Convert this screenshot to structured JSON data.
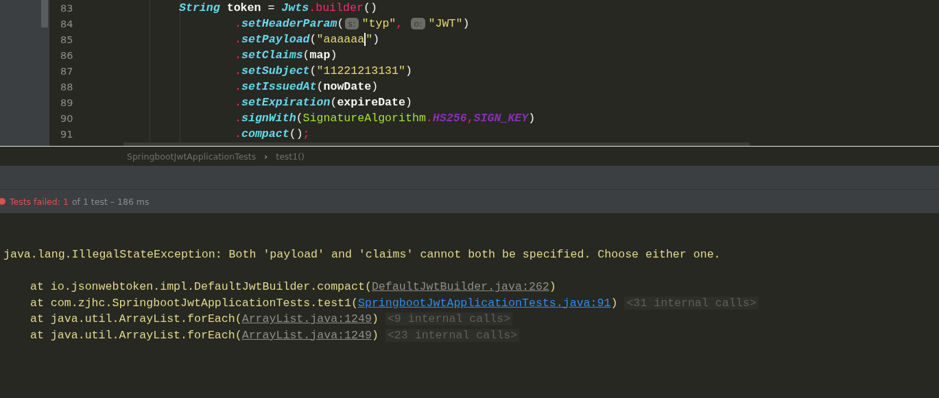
{
  "editor": {
    "lines": [
      {
        "number": "83",
        "kind": "statement",
        "tokens": [
          {
            "kind": "type",
            "text": "String"
          },
          {
            "kind": "ident",
            "text": " token "
          },
          {
            "kind": "plain",
            "text": "= "
          },
          {
            "kind": "type",
            "text": "Jwts"
          },
          {
            "kind": "dot",
            "text": "."
          },
          {
            "kind": "call",
            "text": "builder"
          },
          {
            "kind": "plain",
            "text": "()"
          }
        ]
      },
      {
        "number": "84",
        "kind": "chain",
        "tokens": [
          {
            "kind": "dot",
            "text": "."
          },
          {
            "kind": "method",
            "text": "setHeaderParam"
          },
          {
            "kind": "plain",
            "text": "("
          },
          {
            "kind": "hint",
            "text": "s:"
          },
          {
            "kind": "string",
            "text": "\"typ\""
          },
          {
            "kind": "dot",
            "text": ", "
          },
          {
            "kind": "hint",
            "text": "o:"
          },
          {
            "kind": "string",
            "text": "\"JWT\""
          },
          {
            "kind": "plain",
            "text": ")"
          }
        ]
      },
      {
        "number": "85",
        "kind": "chain",
        "tokens": [
          {
            "kind": "dot",
            "text": "."
          },
          {
            "kind": "method",
            "text": "setPayload"
          },
          {
            "kind": "plain",
            "text": "("
          },
          {
            "kind": "string",
            "text": "\"aaaaaa"
          },
          {
            "kind": "caret"
          },
          {
            "kind": "string",
            "text": "\""
          },
          {
            "kind": "plain",
            "text": ")"
          }
        ]
      },
      {
        "number": "86",
        "kind": "chain",
        "tokens": [
          {
            "kind": "dot",
            "text": "."
          },
          {
            "kind": "method",
            "text": "setClaims"
          },
          {
            "kind": "plain",
            "text": "("
          },
          {
            "kind": "ident",
            "text": "map"
          },
          {
            "kind": "plain",
            "text": ")"
          }
        ]
      },
      {
        "number": "87",
        "kind": "chain",
        "tokens": [
          {
            "kind": "dot",
            "text": "."
          },
          {
            "kind": "method",
            "text": "setSubject"
          },
          {
            "kind": "plain",
            "text": "("
          },
          {
            "kind": "string",
            "text": "\"11221213131\""
          },
          {
            "kind": "plain",
            "text": ")"
          }
        ]
      },
      {
        "number": "88",
        "kind": "chain",
        "tokens": [
          {
            "kind": "dot",
            "text": "."
          },
          {
            "kind": "method",
            "text": "setIssuedAt"
          },
          {
            "kind": "plain",
            "text": "("
          },
          {
            "kind": "ident",
            "text": "nowDate"
          },
          {
            "kind": "plain",
            "text": ")"
          }
        ]
      },
      {
        "number": "89",
        "kind": "chain",
        "tokens": [
          {
            "kind": "dot",
            "text": "."
          },
          {
            "kind": "method",
            "text": "setExpiration"
          },
          {
            "kind": "plain",
            "text": "("
          },
          {
            "kind": "ident",
            "text": "expireDate"
          },
          {
            "kind": "plain",
            "text": ")"
          }
        ]
      },
      {
        "number": "90",
        "kind": "chain",
        "tokens": [
          {
            "kind": "dot",
            "text": "."
          },
          {
            "kind": "method",
            "text": "signWith"
          },
          {
            "kind": "plain",
            "text": "("
          },
          {
            "kind": "class",
            "text": "SignatureAlgorithm"
          },
          {
            "kind": "dot",
            "text": "."
          },
          {
            "kind": "constant",
            "text": "HS256"
          },
          {
            "kind": "dot",
            "text": ","
          },
          {
            "kind": "constant",
            "text": "SIGN_KEY"
          },
          {
            "kind": "plain",
            "text": ")"
          }
        ]
      },
      {
        "number": "91",
        "kind": "chain",
        "tokens": [
          {
            "kind": "dot",
            "text": "."
          },
          {
            "kind": "method",
            "text": "compact"
          },
          {
            "kind": "plain",
            "text": "()"
          },
          {
            "kind": "dot",
            "text": ";"
          }
        ]
      }
    ]
  },
  "breadcrumb": [
    {
      "kind": "crumb",
      "text": "SpringbootJwtApplicationTests"
    },
    {
      "kind": "separator",
      "text": "›"
    },
    {
      "kind": "crumb",
      "text": "test1()"
    }
  ],
  "status": {
    "failed_text": "Tests failed: 1",
    "summary_text": "of 1 test – 186 ms"
  },
  "console": {
    "exception": "java.lang.IllegalStateException: Both 'payload' and 'claims' cannot both be specified. Choose either one.",
    "frames": [
      {
        "prefix": "at io.jsonwebtoken.impl.DefaultJwtBuilder.compact(",
        "link": "DefaultJwtBuilder.java:262",
        "kind": "library",
        "suffix": ")"
      },
      {
        "prefix": "at com.zjhc.SpringbootJwtApplicationTests.test1(",
        "link": "SpringbootJwtApplicationTests.java:91",
        "kind": "project",
        "suffix": ")",
        "internal": "<31 internal calls>"
      },
      {
        "prefix": "at java.util.ArrayList.forEach(",
        "link": "ArrayList.java:1249",
        "kind": "library",
        "suffix": ")",
        "internal": "<9 internal calls>"
      },
      {
        "prefix": "at java.util.ArrayList.forEach(",
        "link": "ArrayList.java:1249",
        "kind": "library",
        "suffix": ")",
        "internal": "<23 internal calls>"
      }
    ]
  }
}
